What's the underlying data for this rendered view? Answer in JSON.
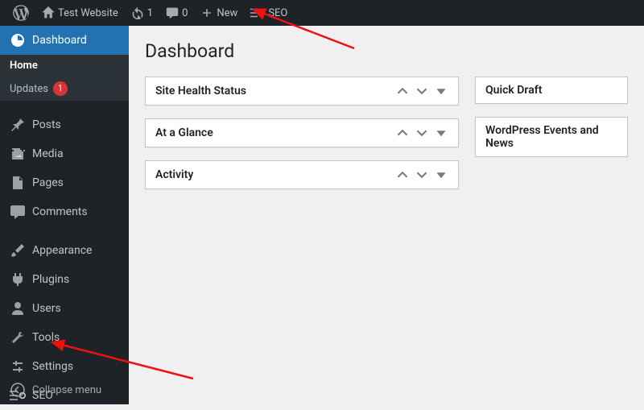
{
  "adminbar": {
    "site_name": "Test Website",
    "updates_count": "1",
    "comments_count": "0",
    "new_label": "New",
    "seo_label": "SEO"
  },
  "sidebar": {
    "dashboard_label": "Dashboard",
    "submenu_home": "Home",
    "submenu_updates": "Updates",
    "updates_badge": "1",
    "posts_label": "Posts",
    "media_label": "Media",
    "pages_label": "Pages",
    "comments_label": "Comments",
    "appearance_label": "Appearance",
    "plugins_label": "Plugins",
    "users_label": "Users",
    "tools_label": "Tools",
    "settings_label": "Settings",
    "seo_label": "SEO",
    "collapse_label": "Collapse menu"
  },
  "main": {
    "title": "Dashboard",
    "boxes": {
      "site_health": "Site Health Status",
      "at_a_glance": "At a Glance",
      "activity": "Activity",
      "quick_draft": "Quick Draft",
      "events_news": "WordPress Events and News"
    }
  }
}
